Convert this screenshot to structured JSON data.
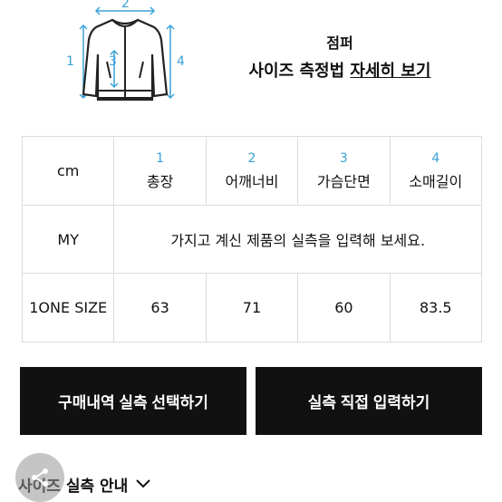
{
  "diagram": {
    "labels": [
      "1",
      "2",
      "3",
      "4"
    ]
  },
  "header": {
    "category": "점퍼",
    "howto_prefix": "사이즈 측정법 ",
    "howto_link": "자세히 보기"
  },
  "table": {
    "unit": "cm",
    "columns": [
      {
        "num": "1",
        "name": "총장"
      },
      {
        "num": "2",
        "name": "어깨너비"
      },
      {
        "num": "3",
        "name": "가슴단면"
      },
      {
        "num": "4",
        "name": "소매길이"
      }
    ],
    "my_label": "MY",
    "my_placeholder": "가지고 계신 제품의 실측을 입력해 보세요.",
    "size_label": "1ONE SIZE",
    "size_values": [
      "63",
      "71",
      "60",
      "83.5"
    ]
  },
  "buttons": {
    "left": "구매내역 실측 선택하기",
    "right": "실측 직접 입력하기"
  },
  "guide": {
    "label": "사이즈 실측 안내"
  },
  "colors": {
    "accent": "#3aa0d8",
    "button_bg": "#111111"
  }
}
